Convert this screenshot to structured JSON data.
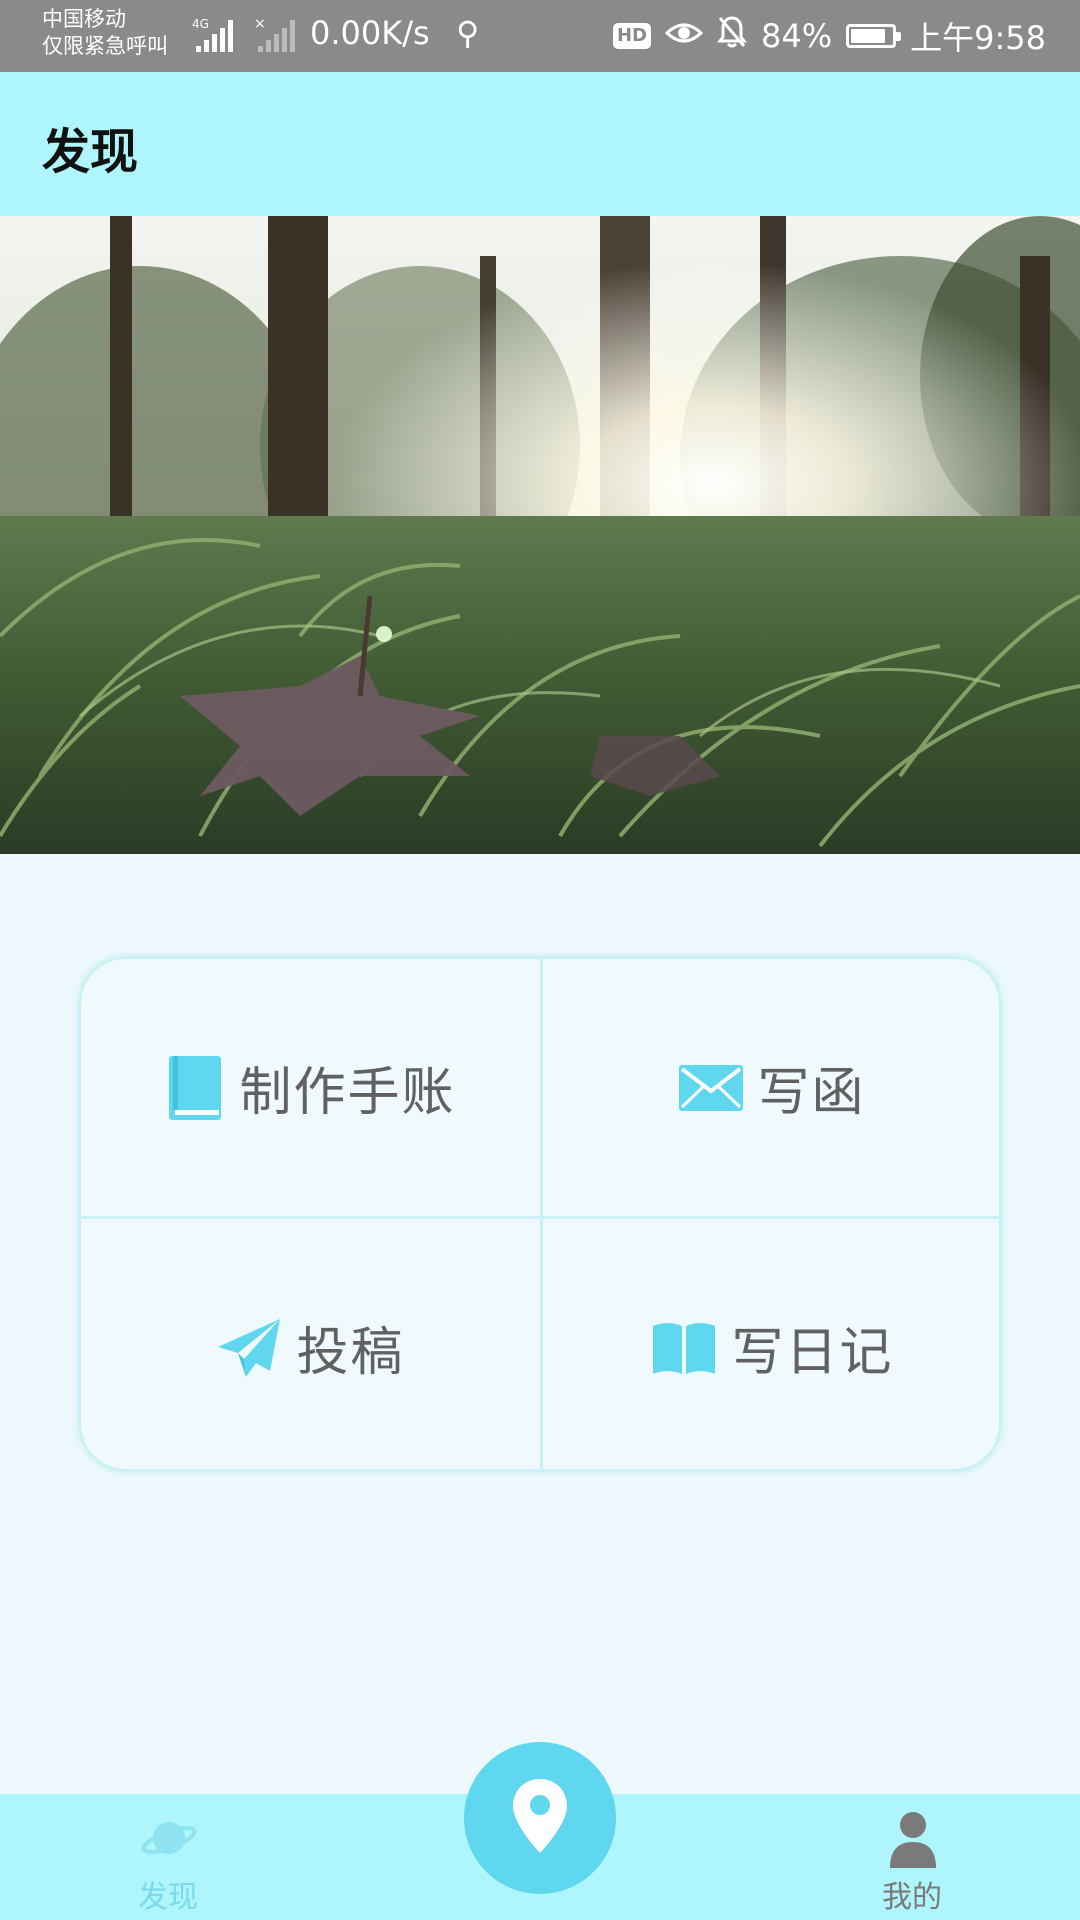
{
  "status_bar": {
    "carrier_line1": "中国移动",
    "carrier_line2": "仅限紧急呼叫",
    "network_type": "4G",
    "net_speed": "0.00K/s",
    "hd_label": "HD",
    "battery_percent": "84%",
    "battery_level": 0.84,
    "time": "上午9:58",
    "icons": [
      "signal-icon",
      "no-signal-icon",
      "usb-icon",
      "hd-icon",
      "eye-icon",
      "bell-off-icon",
      "battery-charging-icon"
    ]
  },
  "app_bar": {
    "title": "发现"
  },
  "banner": {
    "description_icon": "forest-sunlight-banner"
  },
  "actions": [
    {
      "label": "制作手账",
      "icon": "book-icon"
    },
    {
      "label": "写函",
      "icon": "envelope-icon"
    },
    {
      "label": "投稿",
      "icon": "paper-plane-icon"
    },
    {
      "label": "写日记",
      "icon": "open-book-icon"
    }
  ],
  "bottom_nav": {
    "left": {
      "label": "发现",
      "icon": "planet-icon"
    },
    "center": {
      "icon": "location-pin-icon"
    },
    "right": {
      "label": "我的",
      "icon": "user-icon"
    }
  },
  "colors": {
    "accent": "#5ed7ef",
    "app_bar": "#aef6fb",
    "background": "#eef9fd",
    "nav_label_active": "#7ad8ec",
    "nav_label_inactive": "#7a7a7a"
  }
}
